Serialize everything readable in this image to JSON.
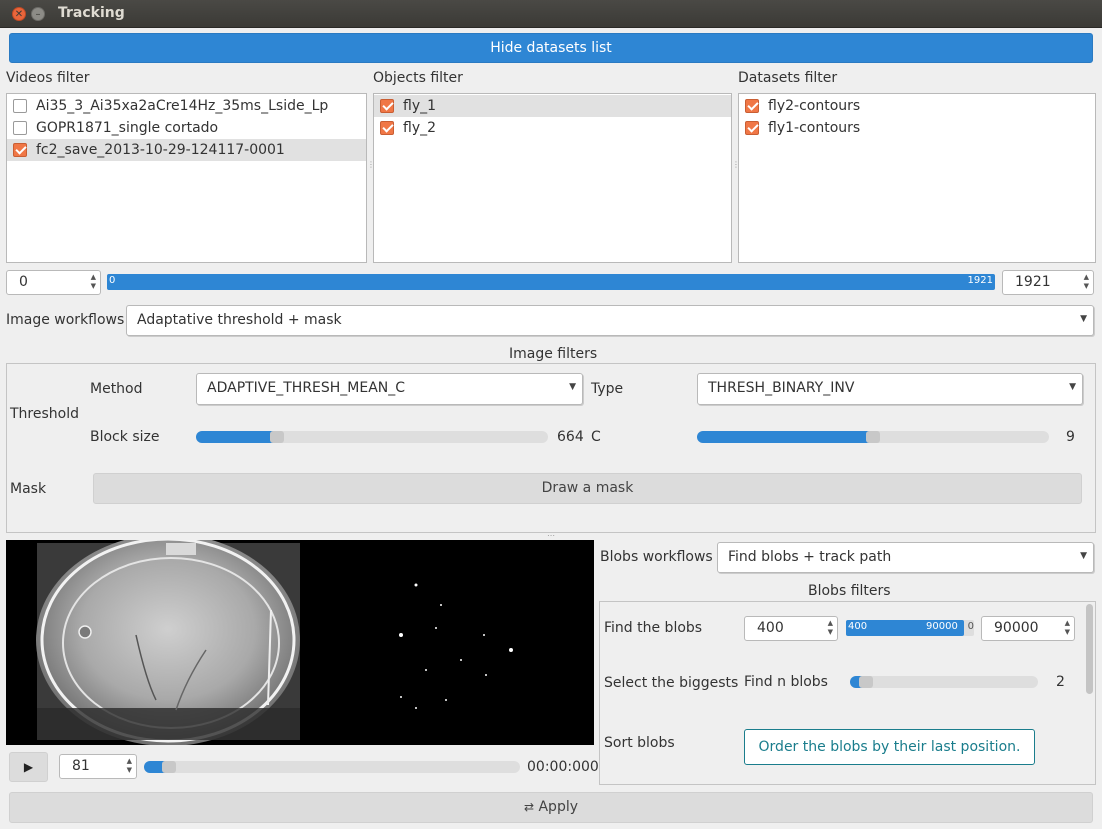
{
  "window": {
    "title": "Tracking"
  },
  "top": {
    "hide_datasets_label": "Hide datasets list"
  },
  "filters": {
    "videos": {
      "title": "Videos filter",
      "items": [
        {
          "label": "Ai35_3_Ai35xa2aCre14Hz_35ms_Lside_Lp",
          "checked": false,
          "selected": false
        },
        {
          "label": "GOPR1871_single cortado",
          "checked": false,
          "selected": false
        },
        {
          "label": "fc2_save_2013-10-29-124117-0001",
          "checked": true,
          "selected": true
        }
      ]
    },
    "objects": {
      "title": "Objects filter",
      "items": [
        {
          "label": "fly_1",
          "checked": true,
          "selected": true
        },
        {
          "label": "fly_2",
          "checked": true,
          "selected": false
        }
      ]
    },
    "datasets": {
      "title": "Datasets filter",
      "items": [
        {
          "label": "fly2-contours",
          "checked": true,
          "selected": false
        },
        {
          "label": "fly1-contours",
          "checked": true,
          "selected": false
        }
      ]
    }
  },
  "range": {
    "start": "0",
    "end": "1921",
    "bar_start_label": "0",
    "bar_end_label": "1921",
    "fill_fraction": 1.0
  },
  "image_workflows": {
    "label": "Image workflows",
    "value": "Adaptative threshold + mask"
  },
  "image_filters": {
    "title": "Image filters",
    "threshold": {
      "label": "Threshold",
      "method_label": "Method",
      "method_value": "ADAPTIVE_THRESH_MEAN_C",
      "type_label": "Type",
      "type_value": "THRESH_BINARY_INV",
      "block_size_label": "Block size",
      "block_size_value": "664",
      "block_size_fraction": 0.22,
      "c_label": "C",
      "c_value": "9",
      "c_fraction": 0.5
    },
    "mask": {
      "label": "Mask",
      "button_label": "Draw a mask"
    }
  },
  "player": {
    "frame": "81",
    "time": "00:00:000",
    "progress_fraction": 0.05
  },
  "blobs": {
    "workflows_label": "Blobs workflows",
    "workflows_value": "Find blobs + track path",
    "filters_title": "Blobs filters",
    "find": {
      "label": "Find the blobs",
      "min": "400",
      "max": "90000",
      "bar_min_label": "400",
      "bar_max_label": "90000",
      "bar_overflow_label": "0"
    },
    "biggest": {
      "label": "Select the biggests",
      "n_label": "Find n blobs",
      "n_value": "2",
      "n_fraction": 0.05
    },
    "sort": {
      "label": "Sort blobs",
      "button_label": "Order the blobs by their last position."
    }
  },
  "apply": {
    "label": "Apply"
  },
  "colors": {
    "accent": "#2e86d4",
    "checkbox": "#f07746",
    "teal": "#1a7d8c"
  }
}
